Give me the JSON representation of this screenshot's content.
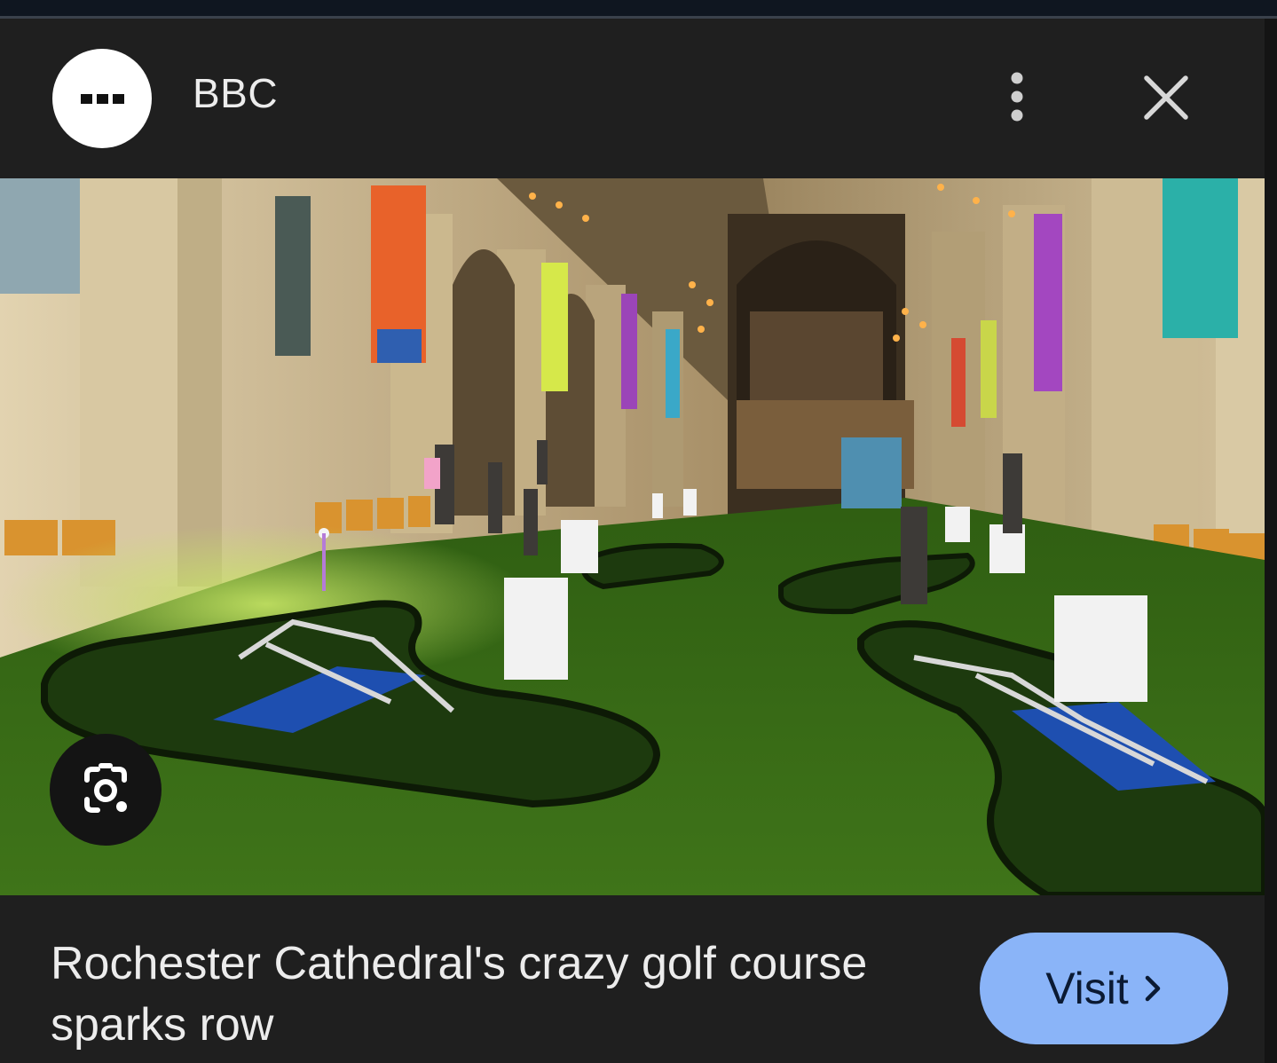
{
  "header": {
    "source_name": "BBC",
    "avatar_icon": "ellipsis-logo-icon",
    "more_icon": "vertical-dots-icon",
    "close_icon": "close-icon"
  },
  "image": {
    "lens_icon": "google-lens-icon"
  },
  "footer": {
    "headline": "Rochester Cathedral's crazy golf course sparks row",
    "visit_label": "Visit",
    "visit_icon": "chevron-right-icon"
  },
  "colors": {
    "panel_background": "#1f1f1f",
    "visit_button": "#8ab4f8",
    "text": "#ececec"
  }
}
